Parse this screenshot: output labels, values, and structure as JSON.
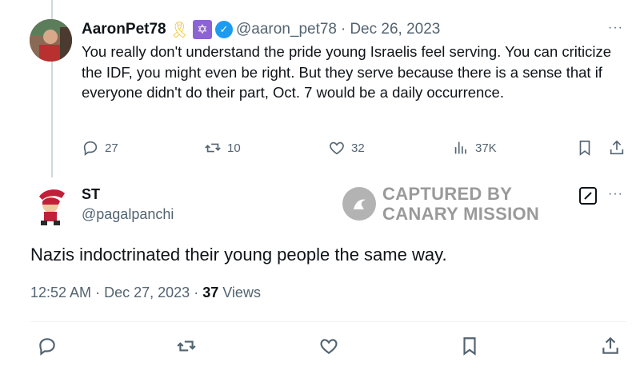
{
  "tweet1": {
    "display_name": "AaronPet78",
    "handle": "@aaron_pet78",
    "separator": "·",
    "date": "Dec 26, 2023",
    "text": "You really don't understand the pride young Israelis feel serving. You can criticize the IDF, you might even be right.  But they serve because there is a sense that if everyone didn't do their part, Oct. 7 would be a daily occurrence.",
    "badges": [
      "yellow-ribbon-icon",
      "star-of-david-icon",
      "verified-icon"
    ],
    "actions": {
      "replies": "27",
      "reposts": "10",
      "likes": "32",
      "views": "37K"
    },
    "more": "···"
  },
  "tweet2": {
    "display_name": "ST",
    "handle": "@pagalpanchi",
    "text": "Nazis indoctrinated their young people the same way.",
    "time": "12:52 AM",
    "date": "Dec 27, 2023",
    "separator": "·",
    "views_count": "37",
    "views_label": "Views",
    "more": "···"
  },
  "watermark": {
    "line1": "CAPTURED BY",
    "line2": "CANARY MISSION"
  },
  "colors": {
    "verified": "#1d9bf0",
    "secondary_text": "#536471",
    "primary_text": "#0f1419",
    "watermark": "#9a9a9a"
  }
}
